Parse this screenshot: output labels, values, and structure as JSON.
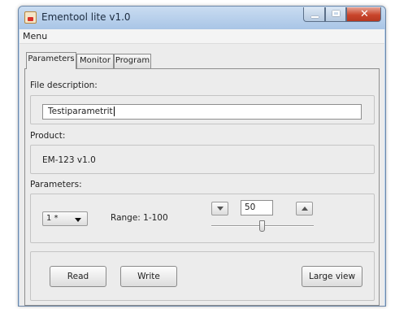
{
  "window": {
    "title": "Ementool lite v1.0"
  },
  "menubar": {
    "menu_label": "Menu"
  },
  "tabs": [
    {
      "label": "Parameters",
      "active": true
    },
    {
      "label": "Monitor",
      "active": false
    },
    {
      "label": "Program",
      "active": false
    }
  ],
  "file_description": {
    "label": "File description:",
    "value": "Testiparametrit"
  },
  "product": {
    "label": "Product:",
    "value": "EM-123  v1.0"
  },
  "parameters": {
    "label": "Parameters:",
    "selected": "1 *",
    "range_text": "Range: 1-100",
    "spinner_value": "50",
    "slider_value": 50,
    "slider_min": 1,
    "slider_max": 100
  },
  "buttons": {
    "read": "Read",
    "write": "Write",
    "large_view": "Large view"
  },
  "colors": {
    "title_bar": "#b9d3ee",
    "close_button": "#c9452c",
    "client_background": "#ececec"
  }
}
